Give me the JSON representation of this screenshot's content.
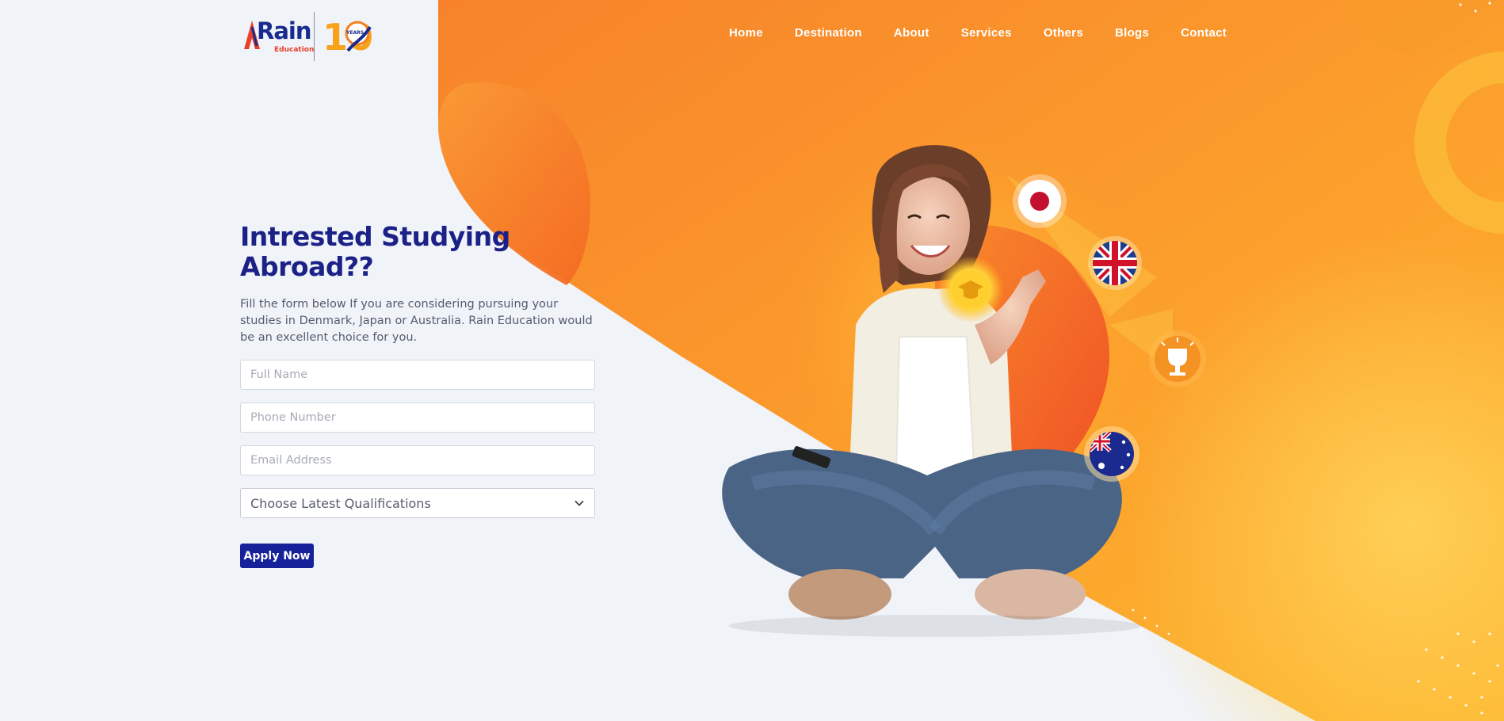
{
  "brand": {
    "logo_word": "Rain",
    "logo_sub": "Education",
    "anniversary_number": "10",
    "anniversary_text": "YEARS"
  },
  "nav": {
    "items": [
      {
        "label": "Home"
      },
      {
        "label": "Destination"
      },
      {
        "label": "About"
      },
      {
        "label": "Services"
      },
      {
        "label": "Others"
      },
      {
        "label": "Blogs"
      },
      {
        "label": "Contact"
      }
    ]
  },
  "hero": {
    "title": "Intrested Studying Abroad??",
    "description": "Fill the form below If you are considering pursuing your studies in Denmark, Japan or Australia. Rain Education would be an excellent choice for you."
  },
  "form": {
    "full_name_placeholder": "Full Name",
    "phone_placeholder": "Phone Number",
    "email_placeholder": "Email Address",
    "qualification_selected": "Choose Latest Qualifications",
    "apply_label": "Apply Now"
  },
  "illustration": {
    "icons": [
      "japan-flag-icon",
      "uk-flag-icon",
      "trophy-icon",
      "australia-flag-icon",
      "graduation-cap-icon"
    ]
  },
  "colors": {
    "primary": "#1b2187",
    "button": "#17229a",
    "accent_orange": "#f7801f",
    "accent_yellow": "#fdb92a",
    "background": "#f0f3f8"
  }
}
